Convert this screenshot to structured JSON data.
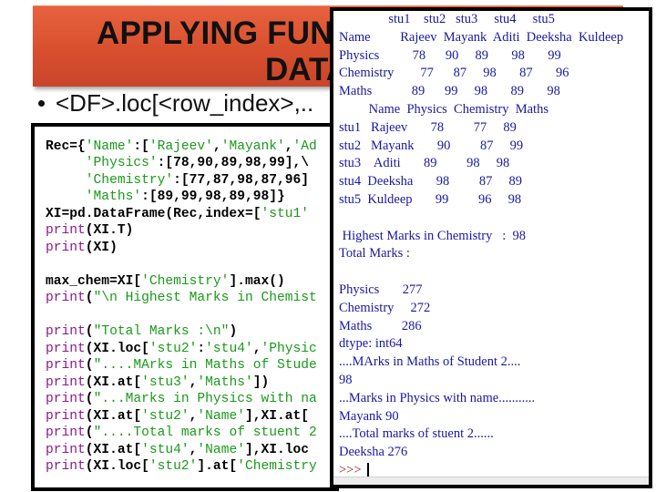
{
  "slide": {
    "title_line1": "APPLYING FUNCTI",
    "title_line2": "DATA F",
    "bullet": "<DF>.loc[<row_index>,..",
    "banner_color": "#d84f2e"
  },
  "code_editor": {
    "lines": [
      [
        {
          "t": "Rec={",
          "c": "bk"
        },
        {
          "t": "'Name'",
          "c": "st"
        },
        {
          "t": ":[",
          "c": "bk"
        },
        {
          "t": "'Rajeev'",
          "c": "st"
        },
        {
          "t": ",",
          "c": "bk"
        },
        {
          "t": "'Mayank'",
          "c": "st"
        },
        {
          "t": ",",
          "c": "bk"
        },
        {
          "t": "'Ad",
          "c": "st"
        }
      ],
      [
        {
          "t": "     ",
          "c": "bk"
        },
        {
          "t": "'Physics'",
          "c": "st"
        },
        {
          "t": ":[78,90,89,98,99],\\",
          "c": "bk"
        }
      ],
      [
        {
          "t": "     ",
          "c": "bk"
        },
        {
          "t": "'Chemistry'",
          "c": "st"
        },
        {
          "t": ":[77,87,98,87,96]",
          "c": "bk"
        }
      ],
      [
        {
          "t": "     ",
          "c": "bk"
        },
        {
          "t": "'Maths'",
          "c": "st"
        },
        {
          "t": ":[89,99,98,89,98]}",
          "c": "bk"
        }
      ],
      [
        {
          "t": "XI=pd.DataFrame(Rec,index=[",
          "c": "bk"
        },
        {
          "t": "'stu1'",
          "c": "st"
        }
      ],
      [
        {
          "t": "print",
          "c": "kw"
        },
        {
          "t": "(XI.T)",
          "c": "bk"
        }
      ],
      [
        {
          "t": "print",
          "c": "kw"
        },
        {
          "t": "(XI)",
          "c": "bk"
        }
      ],
      [],
      [
        {
          "t": "max_chem=XI[",
          "c": "bk"
        },
        {
          "t": "'Chemistry'",
          "c": "st"
        },
        {
          "t": "].max()",
          "c": "bk"
        }
      ],
      [
        {
          "t": "print",
          "c": "kw"
        },
        {
          "t": "(",
          "c": "bk"
        },
        {
          "t": "\"\\n Highest Marks in Chemist",
          "c": "st"
        }
      ],
      [],
      [
        {
          "t": "print",
          "c": "kw"
        },
        {
          "t": "(",
          "c": "bk"
        },
        {
          "t": "\"Total Marks :\\n\"",
          "c": "st"
        },
        {
          "t": ")",
          "c": "bk"
        }
      ],
      [
        {
          "t": "print",
          "c": "kw"
        },
        {
          "t": "(XI.loc[",
          "c": "bk"
        },
        {
          "t": "'stu2'",
          "c": "st"
        },
        {
          "t": ":",
          "c": "bk"
        },
        {
          "t": "'stu4'",
          "c": "st"
        },
        {
          "t": ",",
          "c": "bk"
        },
        {
          "t": "'Physic",
          "c": "st"
        }
      ],
      [
        {
          "t": "print",
          "c": "kw"
        },
        {
          "t": "(",
          "c": "bk"
        },
        {
          "t": "\"....MArks in Maths of Stude",
          "c": "st"
        }
      ],
      [
        {
          "t": "print",
          "c": "kw"
        },
        {
          "t": "(XI.at[",
          "c": "bk"
        },
        {
          "t": "'stu3'",
          "c": "st"
        },
        {
          "t": ",",
          "c": "bk"
        },
        {
          "t": "'Maths'",
          "c": "st"
        },
        {
          "t": "])",
          "c": "bk"
        }
      ],
      [
        {
          "t": "print",
          "c": "kw"
        },
        {
          "t": "(",
          "c": "bk"
        },
        {
          "t": "\"...Marks in Physics with na",
          "c": "st"
        }
      ],
      [
        {
          "t": "print",
          "c": "kw"
        },
        {
          "t": "(XI.at[",
          "c": "bk"
        },
        {
          "t": "'stu2'",
          "c": "st"
        },
        {
          "t": ",",
          "c": "bk"
        },
        {
          "t": "'Name'",
          "c": "st"
        },
        {
          "t": "],XI.at[",
          "c": "bk"
        }
      ],
      [
        {
          "t": "print",
          "c": "kw"
        },
        {
          "t": "(",
          "c": "bk"
        },
        {
          "t": "\"....Total marks of stuent 2",
          "c": "st"
        }
      ],
      [
        {
          "t": "print",
          "c": "kw"
        },
        {
          "t": "(XI.at[",
          "c": "bk"
        },
        {
          "t": "'stu4'",
          "c": "st"
        },
        {
          "t": ",",
          "c": "bk"
        },
        {
          "t": "'Name'",
          "c": "st"
        },
        {
          "t": "],XI.loc",
          "c": "bk"
        }
      ],
      [
        {
          "t": "print",
          "c": "kw"
        },
        {
          "t": "(XI.loc[",
          "c": "bk"
        },
        {
          "t": "'stu2'",
          "c": "st"
        },
        {
          "t": "].at[",
          "c": "bk"
        },
        {
          "t": "'Chemistry",
          "c": "st"
        }
      ]
    ]
  },
  "shell_output": {
    "lines": [
      "               stu1    stu2   stu3     stu4     stu5",
      "Name         Rajeev  Mayank  Aditi  Deeksha  Kuldeep",
      "Physics          78      90     89       98       99",
      "Chemistry        77      87     98       87       96",
      "Maths            89      99     98       89       98",
      "         Name  Physics  Chemistry  Maths",
      "stu1   Rajeev       78         77     89",
      "stu2   Mayank       90         87     99",
      "stu3    Aditi       89         98     98",
      "stu4  Deeksha       98         87     89",
      "stu5  Kuldeep       99         96     98",
      "",
      " Highest Marks in Chemistry   :  98",
      "Total Marks :",
      "",
      "Physics       277",
      "Chemistry     272",
      "Maths         286",
      "dtype: int64",
      "....MArks in Maths of Student 2....",
      "98",
      "...Marks in Physics with name...........",
      "Mayank 90",
      "....Total marks of stuent 2......",
      "Deeksha 276"
    ],
    "prompt": ">>>"
  }
}
